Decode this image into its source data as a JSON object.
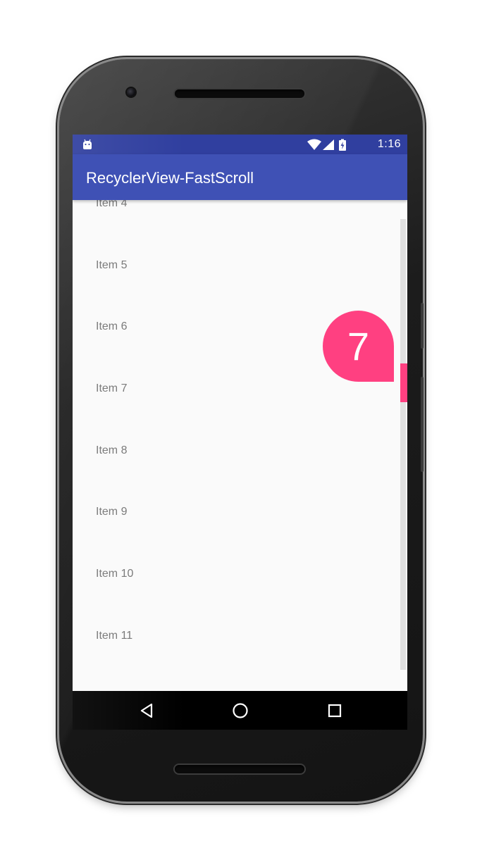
{
  "status_bar": {
    "time": "1:16",
    "icons": [
      "android-icon",
      "wifi-icon",
      "cell-signal-icon",
      "battery-charging-icon"
    ]
  },
  "app_bar": {
    "title": "RecyclerView-FastScroll"
  },
  "list": {
    "items": [
      "Item 4",
      "Item 5",
      "Item 6",
      "Item 7",
      "Item 8",
      "Item 9",
      "Item 10",
      "Item 11"
    ]
  },
  "fast_scroller": {
    "bubble_text": "7",
    "accent_color": "#ff4081",
    "track_color": "#e0e0e0"
  },
  "nav_bar": {
    "buttons": [
      "back-icon",
      "home-icon",
      "recents-icon"
    ]
  },
  "colors": {
    "primary": "#3f51b5",
    "primary_dark": "#303f9f",
    "accent": "#ff4081",
    "background": "#fafafa"
  }
}
